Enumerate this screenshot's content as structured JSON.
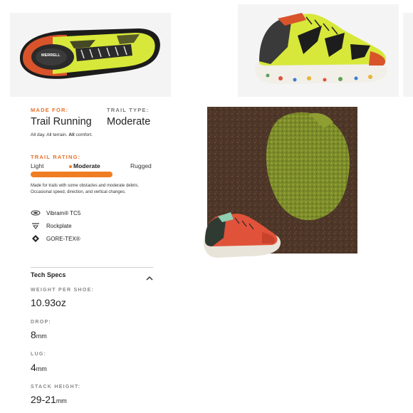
{
  "made_for": {
    "label": "MADE FOR:",
    "value": "Trail Running",
    "desc_pre": "All day. All terrain. ",
    "desc_bold": "All",
    "desc_post": " comfort."
  },
  "trail_type": {
    "label": "TRAIL TYPE:",
    "value": "Moderate"
  },
  "trail_rating": {
    "label": "TRAIL RATING:",
    "levels": [
      "Light",
      "Moderate",
      "Rugged"
    ],
    "selected": "Moderate",
    "bar_fill": 1.0,
    "description_line1": "Made for trails with some obstacles and moderate debris.",
    "description_line2": "Occasional speed, direction, and vertical changes."
  },
  "features": [
    {
      "icon": "vibram-sole-icon",
      "label": "Vibram® TC5"
    },
    {
      "icon": "rockplate-icon",
      "label": "Rockplate"
    },
    {
      "icon": "gore-tex-diamond-icon",
      "label": "GORE-TEX®"
    }
  ],
  "tech_specs": {
    "title": "Tech Specs",
    "toggle_icon": "chevron-up-icon",
    "items": [
      {
        "label": "WEIGHT PER SHOE:",
        "value": "10.93oz",
        "unit": ""
      },
      {
        "label": "DROP:",
        "value": "8",
        "unit": "mm"
      },
      {
        "label": "LUG:",
        "value": "4",
        "unit": "mm"
      },
      {
        "label": "STACK HEIGHT:",
        "value": "29-21",
        "unit": "mm"
      }
    ]
  },
  "brand": {
    "logo_text": "MERRELL"
  },
  "colors": {
    "accent_orange": "#f07d22",
    "shoe_yellow": "#d9ea3a",
    "shoe_red": "#e0533a",
    "soil": "#4a3326",
    "moss": "#7c8a28"
  }
}
